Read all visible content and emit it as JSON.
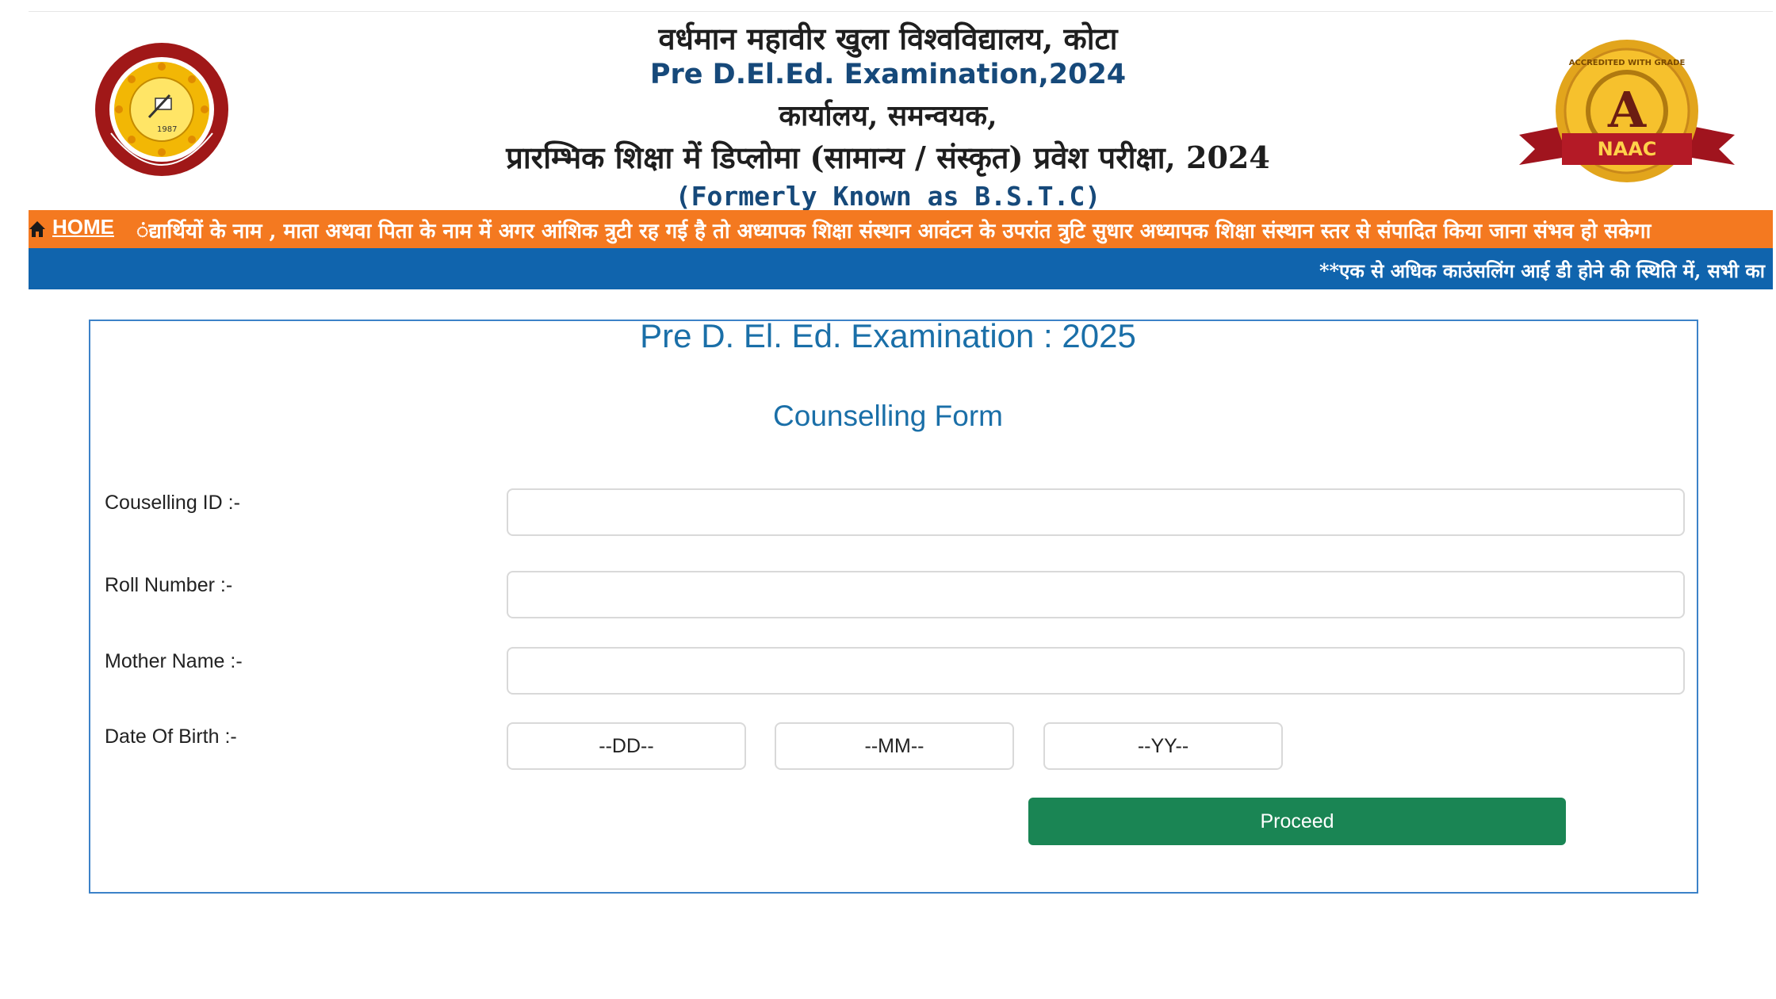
{
  "header": {
    "university_hindi": "वर्धमान महावीर खुला विश्वविद्यालय, कोटा",
    "exam_title": "Pre D.El.Ed. Examination,2024",
    "office_hindi": "कार्यालय, समन्वयक,",
    "exam_hindi": "प्रारम्भिक शिक्षा में डिप्लोमा (सामान्य / संस्कृत) प्रवेश परीक्षा, 2024",
    "formerly": "(Formerly Known as B.S.T.C)",
    "naac_grade": "A",
    "naac_label": "NAAC",
    "naac_ribbon": "ACCREDITED WITH GRADE"
  },
  "nav": {
    "home_label": "HOME",
    "marquee_orange": "ंद्यार्थियों के नाम , माता अथवा पिता के नाम में अगर आंशिक त्रुटी रह गई है तो अध्यापक शिक्षा संस्थान आवंटन के उपरांत त्रुटि सुधार अध्यापक शिक्षा संस्थान स्तर से संपादित किया जाना संभव हो सकेगा",
    "marquee_blue": "**एक से अधिक काउंसलिंग आई डी होने की स्थिति में, सभी का"
  },
  "form": {
    "title": "Pre D. El. Ed. Examination : 2025",
    "subtitle": "Counselling Form",
    "counselling_id_label": "Couselling ID :-",
    "roll_number_label": "Roll Number :-",
    "mother_name_label": "Mother Name :-",
    "dob_label": "Date Of Birth :-",
    "counselling_id_value": "",
    "roll_number_value": "",
    "mother_name_value": "",
    "dob_day": "--DD--",
    "dob_month": "--MM--",
    "dob_year": "--YY--",
    "proceed_label": "Proceed"
  },
  "colors": {
    "orange_bar": "#f47920",
    "blue_bar": "#1064ad",
    "title_blue": "#1a6fa8",
    "proceed_green": "#1a8554"
  }
}
